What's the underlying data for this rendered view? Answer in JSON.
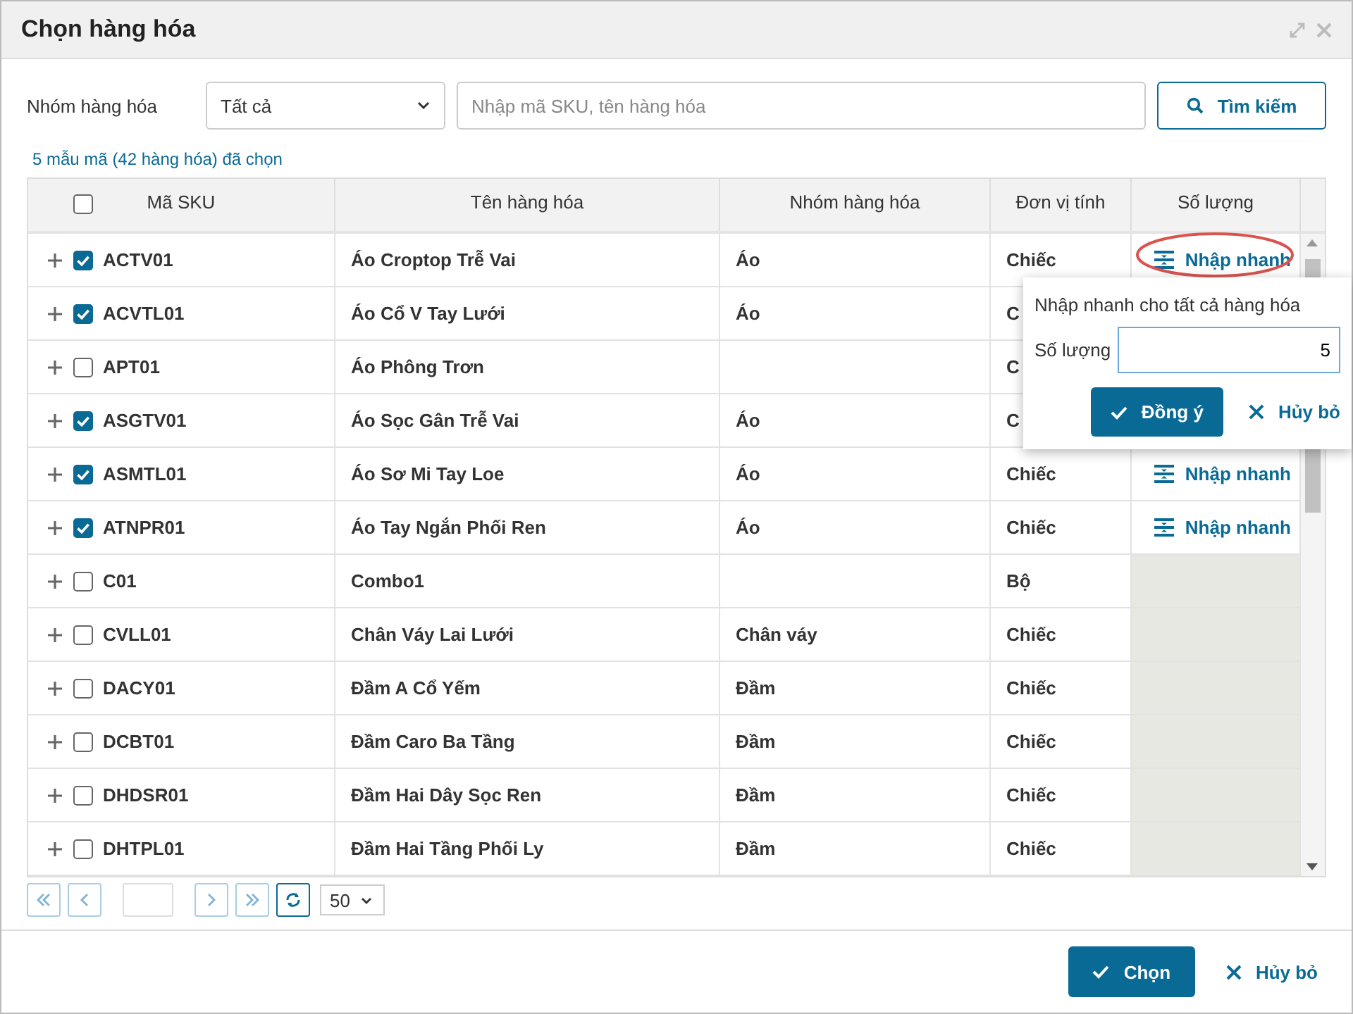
{
  "window": {
    "title": "Chọn hàng hóa"
  },
  "filter": {
    "label": "Nhóm hàng hóa",
    "group_value": "Tất cả",
    "search_placeholder": "Nhập mã SKU, tên hàng hóa",
    "search_button": "Tìm kiếm"
  },
  "selection_summary": "5 mẫu mã (42 hàng hóa) đã chọn",
  "table": {
    "select_all_checked": false,
    "columns": [
      "Mã SKU",
      "Tên hàng hóa",
      "Nhóm hàng hóa",
      "Đơn vị tính",
      "Số lượng"
    ],
    "rows": [
      {
        "sku": "ACTV01",
        "name": "Áo Croptop Trễ Vai",
        "group": "Áo",
        "unit": "Chiếc",
        "checked": true,
        "quick_entry": {
          "label": "Nhập nhanh",
          "highlighted": true
        }
      },
      {
        "sku": "ACVTL01",
        "name": "Áo Cổ V Tay Lưới",
        "group": "Áo",
        "unit": "C",
        "checked": true
      },
      {
        "sku": "APT01",
        "name": "Áo Phông Trơn",
        "group": "",
        "unit": "C",
        "checked": false
      },
      {
        "sku": "ASGTV01",
        "name": "Áo Sọc Gân Trễ Vai",
        "group": "Áo",
        "unit": "C",
        "checked": true
      },
      {
        "sku": "ASMTL01",
        "name": "Áo Sơ Mi Tay Loe",
        "group": "Áo",
        "unit": "Chiếc",
        "checked": true,
        "quick_entry": {
          "label": "Nhập nhanh",
          "highlighted": false
        }
      },
      {
        "sku": "ATNPR01",
        "name": "Áo Tay Ngắn Phối Ren",
        "group": "Áo",
        "unit": "Chiếc",
        "checked": true,
        "quick_entry": {
          "label": "Nhập nhanh",
          "highlighted": false
        }
      },
      {
        "sku": "C01",
        "name": "Combo1",
        "group": "",
        "unit": "Bộ",
        "checked": false,
        "qty_disabled": true
      },
      {
        "sku": "CVLL01",
        "name": "Chân Váy Lai Lưới",
        "group": "Chân váy",
        "unit": "Chiếc",
        "checked": false,
        "qty_disabled": true
      },
      {
        "sku": "DACY01",
        "name": "Đầm A Cổ Yếm",
        "group": "Đầm",
        "unit": "Chiếc",
        "checked": false,
        "qty_disabled": true
      },
      {
        "sku": "DCBT01",
        "name": "Đầm Caro Ba Tầng",
        "group": "Đầm",
        "unit": "Chiếc",
        "checked": false,
        "qty_disabled": true
      },
      {
        "sku": "DHDSR01",
        "name": "Đầm Hai Dây Sọc Ren",
        "group": "Đầm",
        "unit": "Chiếc",
        "checked": false,
        "qty_disabled": true
      },
      {
        "sku": "DHTPL01",
        "name": "Đầm Hai Tầng Phối Ly",
        "group": "Đầm",
        "unit": "Chiếc",
        "checked": false,
        "qty_disabled": true
      }
    ]
  },
  "quick_entry_popup": {
    "title": "Nhập nhanh cho tất cả hàng hóa",
    "field_label": "Số lượng",
    "field_value": "5",
    "confirm": "Đồng ý",
    "cancel": "Hủy bỏ"
  },
  "pager": {
    "page_size": "50"
  },
  "footer": {
    "confirm": "Chọn",
    "cancel": "Hủy bỏ"
  }
}
